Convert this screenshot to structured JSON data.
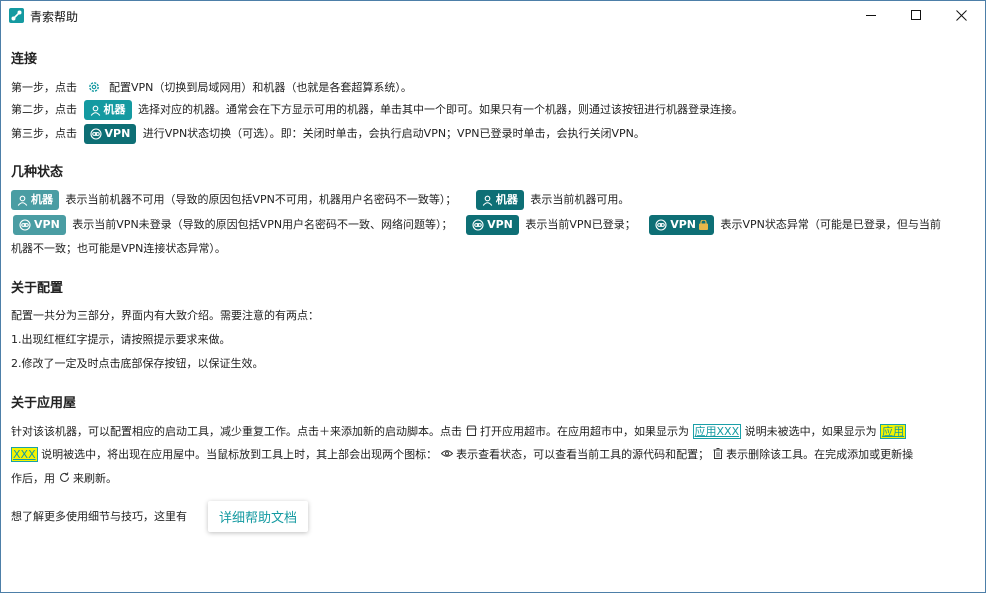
{
  "window": {
    "title": "青索帮助"
  },
  "sections": {
    "connect": {
      "heading": "连接",
      "step1_a": "第一步，点击",
      "step1_b": "配置VPN（切换到局域网用）和机器（也就是各套超算系统）。",
      "step2_a": "第二步，点击",
      "step2_b": "选择对应的机器。通常会在下方显示可用的机器，单击其中一个即可。如果只有一个机器，则通过该按钮进行机器登录连接。",
      "step3_a": "第三步，点击",
      "step3_b": "进行VPN状态切换（可选）。即：关闭时单击，会执行启动VPN；VPN已登录时单击，会执行关闭VPN。"
    },
    "states": {
      "heading": "几种状态",
      "machine_unavail": "表示当前机器不可用（导致的原因包括VPN不可用，机器用户名密码不一致等）；",
      "machine_avail": "表示当前机器可用。",
      "vpn_not_logged": "表示当前VPN未登录（导致的原因包括VPN用户名密码不一致、网络问题等）；",
      "vpn_logged": "表示当前VPN已登录；",
      "vpn_abnormal_a": "表示VPN状态异常（可能是已登录，但与当前",
      "vpn_abnormal_b": "机器不一致；也可能是VPN连接状态异常）。"
    },
    "config": {
      "heading": "关于配置",
      "intro": "配置一共分为三部分，界面内有大致介绍。需要注意的有两点：",
      "point1": "1.出现红框红字提示，请按照提示要求来做。",
      "point2": "2.修改了一定及时点击底部保存按钮，以保证生效。"
    },
    "apps": {
      "heading": "关于应用屋",
      "p1_a": "针对该该机器，可以配置相应的启动工具，减少重复工作。点击＋来添加新的启动脚本。点击",
      "p1_b": "打开应用超市。在应用超市中，如果显示为",
      "hl1": "应用XXX",
      "p1_c": "说明未被选中，如果显示为",
      "hl2a": "应用",
      "hl2b": "XXX",
      "p2_a": "说明被选中，将出现在应用屋中。当鼠标放到工具上时，其上部会出现两个图标：",
      "p2_b": "表示查看状态，可以查看当前工具的源代码和配置；",
      "p2_c": "表示删除该工具。在完成添加或更新操",
      "p3_a": "作后，用",
      "p3_b": "来刷新。"
    },
    "more": {
      "text": "想了解更多使用细节与技巧，这里有",
      "link": "详细帮助文档"
    }
  },
  "tags": {
    "machine": "机器",
    "vpn": "VPN"
  },
  "colors": {
    "accent": "#149aa1",
    "highlight_yellow": "#f4f400",
    "border": "#4d7fa8"
  },
  "icons": [
    "app-logo-icon",
    "minimize-icon",
    "maximize-icon",
    "close-icon",
    "gear-icon",
    "user-icon",
    "link-icon",
    "lock-icon",
    "store-icon",
    "eye-icon",
    "trash-icon",
    "refresh-icon"
  ]
}
